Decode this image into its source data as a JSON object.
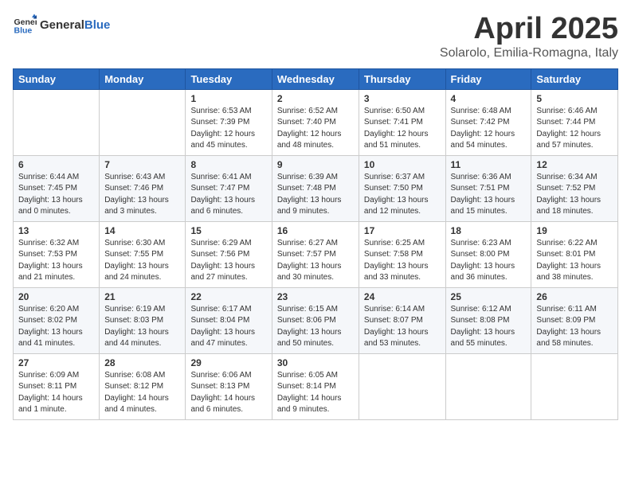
{
  "header": {
    "logo_general": "General",
    "logo_blue": "Blue",
    "month_title": "April 2025",
    "location": "Solarolo, Emilia-Romagna, Italy"
  },
  "weekdays": [
    "Sunday",
    "Monday",
    "Tuesday",
    "Wednesday",
    "Thursday",
    "Friday",
    "Saturday"
  ],
  "weeks": [
    [
      {
        "day": "",
        "info": ""
      },
      {
        "day": "",
        "info": ""
      },
      {
        "day": "1",
        "info": "Sunrise: 6:53 AM\nSunset: 7:39 PM\nDaylight: 12 hours and 45 minutes."
      },
      {
        "day": "2",
        "info": "Sunrise: 6:52 AM\nSunset: 7:40 PM\nDaylight: 12 hours and 48 minutes."
      },
      {
        "day": "3",
        "info": "Sunrise: 6:50 AM\nSunset: 7:41 PM\nDaylight: 12 hours and 51 minutes."
      },
      {
        "day": "4",
        "info": "Sunrise: 6:48 AM\nSunset: 7:42 PM\nDaylight: 12 hours and 54 minutes."
      },
      {
        "day": "5",
        "info": "Sunrise: 6:46 AM\nSunset: 7:44 PM\nDaylight: 12 hours and 57 minutes."
      }
    ],
    [
      {
        "day": "6",
        "info": "Sunrise: 6:44 AM\nSunset: 7:45 PM\nDaylight: 13 hours and 0 minutes."
      },
      {
        "day": "7",
        "info": "Sunrise: 6:43 AM\nSunset: 7:46 PM\nDaylight: 13 hours and 3 minutes."
      },
      {
        "day": "8",
        "info": "Sunrise: 6:41 AM\nSunset: 7:47 PM\nDaylight: 13 hours and 6 minutes."
      },
      {
        "day": "9",
        "info": "Sunrise: 6:39 AM\nSunset: 7:48 PM\nDaylight: 13 hours and 9 minutes."
      },
      {
        "day": "10",
        "info": "Sunrise: 6:37 AM\nSunset: 7:50 PM\nDaylight: 13 hours and 12 minutes."
      },
      {
        "day": "11",
        "info": "Sunrise: 6:36 AM\nSunset: 7:51 PM\nDaylight: 13 hours and 15 minutes."
      },
      {
        "day": "12",
        "info": "Sunrise: 6:34 AM\nSunset: 7:52 PM\nDaylight: 13 hours and 18 minutes."
      }
    ],
    [
      {
        "day": "13",
        "info": "Sunrise: 6:32 AM\nSunset: 7:53 PM\nDaylight: 13 hours and 21 minutes."
      },
      {
        "day": "14",
        "info": "Sunrise: 6:30 AM\nSunset: 7:55 PM\nDaylight: 13 hours and 24 minutes."
      },
      {
        "day": "15",
        "info": "Sunrise: 6:29 AM\nSunset: 7:56 PM\nDaylight: 13 hours and 27 minutes."
      },
      {
        "day": "16",
        "info": "Sunrise: 6:27 AM\nSunset: 7:57 PM\nDaylight: 13 hours and 30 minutes."
      },
      {
        "day": "17",
        "info": "Sunrise: 6:25 AM\nSunset: 7:58 PM\nDaylight: 13 hours and 33 minutes."
      },
      {
        "day": "18",
        "info": "Sunrise: 6:23 AM\nSunset: 8:00 PM\nDaylight: 13 hours and 36 minutes."
      },
      {
        "day": "19",
        "info": "Sunrise: 6:22 AM\nSunset: 8:01 PM\nDaylight: 13 hours and 38 minutes."
      }
    ],
    [
      {
        "day": "20",
        "info": "Sunrise: 6:20 AM\nSunset: 8:02 PM\nDaylight: 13 hours and 41 minutes."
      },
      {
        "day": "21",
        "info": "Sunrise: 6:19 AM\nSunset: 8:03 PM\nDaylight: 13 hours and 44 minutes."
      },
      {
        "day": "22",
        "info": "Sunrise: 6:17 AM\nSunset: 8:04 PM\nDaylight: 13 hours and 47 minutes."
      },
      {
        "day": "23",
        "info": "Sunrise: 6:15 AM\nSunset: 8:06 PM\nDaylight: 13 hours and 50 minutes."
      },
      {
        "day": "24",
        "info": "Sunrise: 6:14 AM\nSunset: 8:07 PM\nDaylight: 13 hours and 53 minutes."
      },
      {
        "day": "25",
        "info": "Sunrise: 6:12 AM\nSunset: 8:08 PM\nDaylight: 13 hours and 55 minutes."
      },
      {
        "day": "26",
        "info": "Sunrise: 6:11 AM\nSunset: 8:09 PM\nDaylight: 13 hours and 58 minutes."
      }
    ],
    [
      {
        "day": "27",
        "info": "Sunrise: 6:09 AM\nSunset: 8:11 PM\nDaylight: 14 hours and 1 minute."
      },
      {
        "day": "28",
        "info": "Sunrise: 6:08 AM\nSunset: 8:12 PM\nDaylight: 14 hours and 4 minutes."
      },
      {
        "day": "29",
        "info": "Sunrise: 6:06 AM\nSunset: 8:13 PM\nDaylight: 14 hours and 6 minutes."
      },
      {
        "day": "30",
        "info": "Sunrise: 6:05 AM\nSunset: 8:14 PM\nDaylight: 14 hours and 9 minutes."
      },
      {
        "day": "",
        "info": ""
      },
      {
        "day": "",
        "info": ""
      },
      {
        "day": "",
        "info": ""
      }
    ]
  ]
}
